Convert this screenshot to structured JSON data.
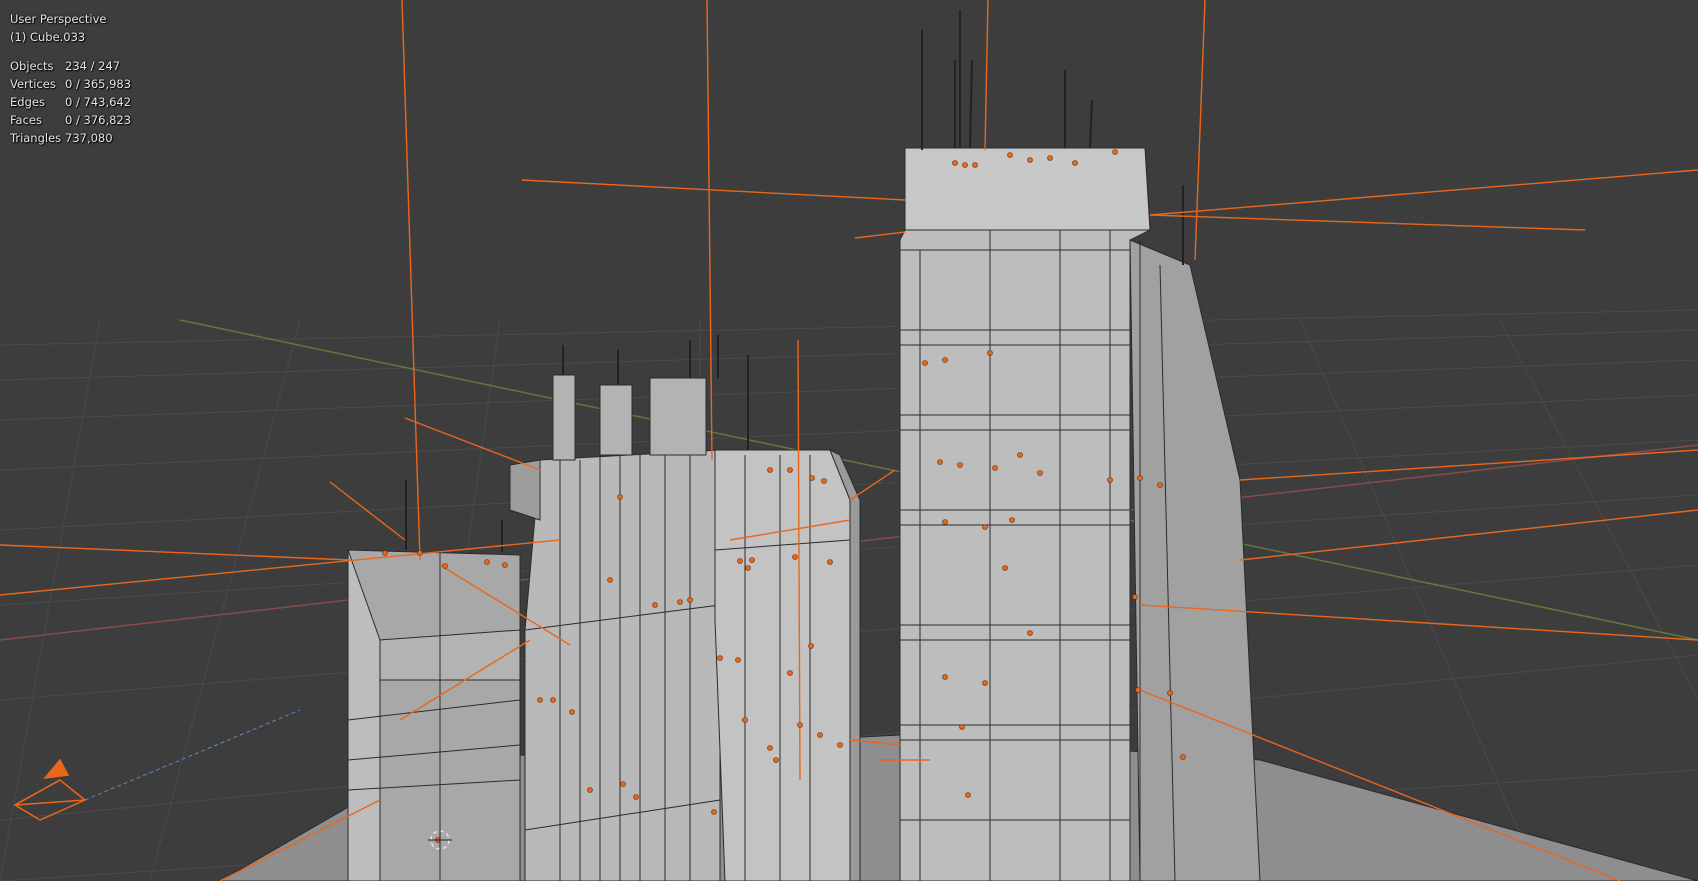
{
  "viewport": {
    "view_name": "User Perspective",
    "active_object": "(1) Cube.033",
    "stats": [
      {
        "label": "Objects",
        "value": "234 / 247"
      },
      {
        "label": "Vertices",
        "value": "0 / 365,983"
      },
      {
        "label": "Edges",
        "value": "0 / 743,642"
      },
      {
        "label": "Faces",
        "value": "0 / 376,823"
      },
      {
        "label": "Triangles",
        "value": "737,080"
      }
    ]
  },
  "colors": {
    "background": "#3d3d3d",
    "grid": "#4a4a4a",
    "x_axis": "#8a4a4a",
    "y_axis": "#5f7a3a",
    "selection": "#e8671c",
    "building_light": "#bdbdbd",
    "building_mid": "#a8a8a8",
    "building_dark": "#8e8e8e",
    "edge": "#2b2b2b"
  }
}
